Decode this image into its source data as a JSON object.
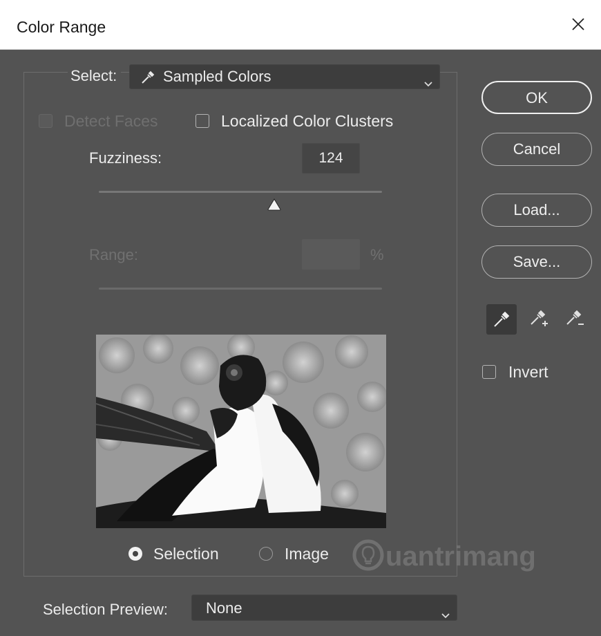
{
  "window": {
    "title": "Color Range",
    "close_icon": "close-icon"
  },
  "select": {
    "label": "Select:",
    "value": "Sampled Colors",
    "icon": "eyedropper-icon"
  },
  "options": {
    "detect_faces": {
      "label": "Detect Faces",
      "checked": false,
      "enabled": false
    },
    "localized_clusters": {
      "label": "Localized Color Clusters",
      "checked": false
    }
  },
  "fuzziness": {
    "label": "Fuzziness:",
    "value": "124",
    "slider_fraction": 0.62
  },
  "range": {
    "label": "Range:",
    "value": "",
    "unit": "%",
    "enabled": false
  },
  "preview_mode": {
    "selection_label": "Selection",
    "image_label": "Image",
    "selected": "Selection"
  },
  "selection_preview": {
    "label": "Selection Preview:",
    "value": "None"
  },
  "buttons": {
    "ok": "OK",
    "cancel": "Cancel",
    "load": "Load...",
    "save": "Save..."
  },
  "eyedroppers": [
    "eyedropper-icon",
    "add-to-sample-icon",
    "subtract-from-sample-icon"
  ],
  "invert": {
    "label": "Invert",
    "checked": false
  },
  "watermark": {
    "text": "uantrimang"
  },
  "colors": {
    "dialog_bg": "#535353",
    "field_bg": "#3d3d3d",
    "title_bg": "#ffffff",
    "text": "#ececec",
    "disabled_text": "#707070"
  }
}
